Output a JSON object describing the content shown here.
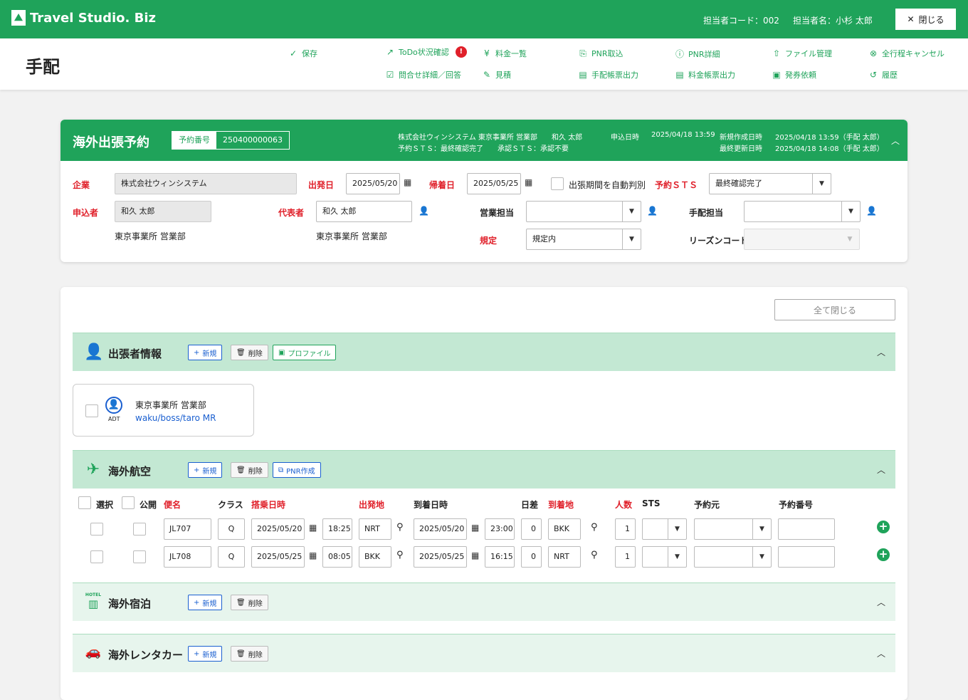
{
  "brand": "Travel Studio. Biz",
  "topbar": {
    "agent_code": "担当者コード：002",
    "agent_name": "担当者名：小杉 太郎",
    "close_label": "閉じる"
  },
  "page_title": "手配",
  "toolbar": {
    "save": "保存",
    "todo": "ToDo状況確認",
    "todo_badge": "!",
    "fee_list": "料金一覧",
    "pnr_import": "PNR取込",
    "pnr_detail": "PNR詳細",
    "file_mgmt": "ファイル管理",
    "cancel_all": "全行程キャンセル",
    "inquiry": "問合せ詳細／回答",
    "estimate": "見積",
    "arrange_print": "手配帳票出力",
    "fee_print": "料金帳票出力",
    "ticket_request": "発券依頼",
    "history": "履歴"
  },
  "booking": {
    "title": "海外出張予約",
    "rsv_label": "予約番号",
    "rsv_no": "250400000063",
    "company_line": "株式会社ウィンシステム 東京事業所 営業部　　和久 太郎",
    "sts_line": "予約ＳＴＳ：最終確認完了　　承認ＳＴＳ：承認不要",
    "applied_label": "申込日時",
    "applied_value": "2025/04/18 13:59",
    "created_label": "新規作成日時",
    "created_value": "2025/04/18 13:59（手配 太郎）",
    "updated_label": "最終更新日時",
    "updated_value": "2025/04/18 14:08（手配 太郎）",
    "company_label": "企業",
    "company_value": "株式会社ウィンシステム",
    "depart_label": "出発日",
    "depart_value": "2025/05/20",
    "return_label": "帰着日",
    "return_value": "2025/05/25",
    "auto_judge": "出張期間を自動判別",
    "sts_label": "予約ＳＴＳ",
    "sts_value": "最終確認完了",
    "applicant_label": "申込者",
    "applicant_value": "和久 太郎",
    "applicant_dept": "東京事業所 営業部",
    "rep_label": "代表者",
    "rep_value": "和久 太郎",
    "rep_dept": "東京事業所 営業部",
    "sales_label": "営業担当",
    "arrange_label": "手配担当",
    "rule_label": "規定",
    "rule_value": "規定内",
    "reason_label": "リーズンコード"
  },
  "close_all": "全て閉じる",
  "btn_new": "新規",
  "btn_delete": "削除",
  "sections": {
    "traveler": {
      "title": "出張者情報",
      "profile": "プロファイル"
    },
    "air": {
      "title": "海外航空",
      "pnr_create": "PNR作成"
    },
    "hotel": {
      "title": "海外宿泊",
      "icon_text": "HOTEL"
    },
    "car": {
      "title": "海外レンタカー"
    }
  },
  "traveler_card": {
    "type": "ADT",
    "dept": "東京事業所 営業部",
    "name": "waku/boss/taro MR"
  },
  "air_table": {
    "headers": [
      "選択",
      "公開",
      "便名",
      "クラス",
      "搭乗日時",
      "出発地",
      "到着日時",
      "日差",
      "到着地",
      "人数",
      "STS",
      "予約元",
      "予約番号"
    ],
    "rows": [
      {
        "flight": "JL707",
        "class": "Q",
        "dep_date": "2025/05/20",
        "dep_time": "18:25",
        "from": "NRT",
        "arr_date": "2025/05/20",
        "arr_time": "23:00",
        "diff": "0",
        "to": "BKK",
        "pax": "1"
      },
      {
        "flight": "JL708",
        "class": "Q",
        "dep_date": "2025/05/25",
        "dep_time": "08:05",
        "from": "BKK",
        "arr_date": "2025/05/25",
        "arr_time": "16:15",
        "diff": "0",
        "to": "NRT",
        "pax": "1"
      }
    ]
  }
}
